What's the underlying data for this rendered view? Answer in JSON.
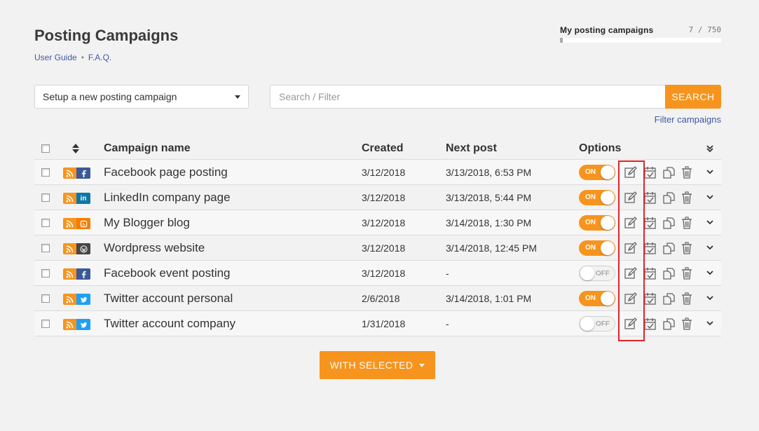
{
  "page": {
    "title": "Posting Campaigns",
    "user_guide": "User Guide",
    "faq": "F.A.Q."
  },
  "quota": {
    "label": "My posting campaigns",
    "count": "7 / 750",
    "used": 7,
    "total": 750
  },
  "toolbar": {
    "setup_select": "Setup a new posting campaign",
    "search_placeholder": "Search / Filter",
    "search_button": "SEARCH",
    "filter_link": "Filter campaigns"
  },
  "table": {
    "columns": {
      "name": "Campaign name",
      "created": "Created",
      "next_post": "Next post",
      "options": "Options"
    },
    "rows": [
      {
        "network": "facebook",
        "icon": "facebook-icon",
        "name": "Facebook page posting",
        "created": "3/12/2018",
        "next_post": "3/13/2018, 6:53 PM",
        "status": "ON"
      },
      {
        "network": "linkedin",
        "icon": "linkedin-icon",
        "name": "LinkedIn company page",
        "created": "3/12/2018",
        "next_post": "3/13/2018, 5:44 PM",
        "status": "ON"
      },
      {
        "network": "blogger",
        "icon": "blogger-icon",
        "name": "My Blogger blog",
        "created": "3/12/2018",
        "next_post": "3/14/2018, 1:30 PM",
        "status": "ON"
      },
      {
        "network": "wordpress",
        "icon": "wordpress-icon",
        "name": "Wordpress website",
        "created": "3/12/2018",
        "next_post": "3/14/2018, 12:45 PM",
        "status": "ON"
      },
      {
        "network": "facebook",
        "icon": "facebook-icon",
        "name": "Facebook event posting",
        "created": "3/12/2018",
        "next_post": "-",
        "status": "OFF"
      },
      {
        "network": "twitter",
        "icon": "twitter-icon",
        "name": "Twitter account personal",
        "created": "2/6/2018",
        "next_post": "3/14/2018, 1:01 PM",
        "status": "ON"
      },
      {
        "network": "twitter",
        "icon": "twitter-icon",
        "name": "Twitter account company",
        "created": "1/31/2018",
        "next_post": "-",
        "status": "OFF"
      }
    ]
  },
  "bulk": {
    "with_selected": "WITH SELECTED"
  },
  "colors": {
    "accent": "#f7941d",
    "link": "#3d5a9e",
    "highlight": "#e0242b"
  }
}
